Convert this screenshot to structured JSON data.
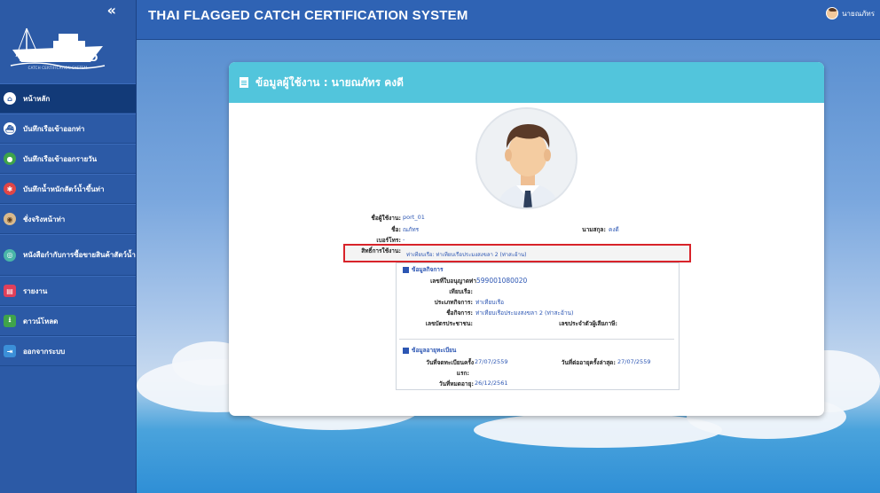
{
  "app": {
    "collapse_label": "«",
    "logo_text": "THAI FLAGGED",
    "logo_sub": "CATCH CERTIFICATION SYSTEM",
    "title": "THAI FLAGGED CATCH CERTIFICATION SYSTEM",
    "user_name": "นายณภัทร"
  },
  "sidebar": {
    "items": [
      {
        "label": "หน้าหลัก",
        "icon": "home-icon"
      },
      {
        "label": "บันทึกเรือเข้าออกท่า",
        "icon": "boat-icon"
      },
      {
        "label": "บันทึกเรือเข้าออกรายวัน",
        "icon": "calendar-boat-icon"
      },
      {
        "label": "บันทึกน้ำหนักสัตว์น้ำขึ้นท่า",
        "icon": "fish-icon"
      },
      {
        "label": "ชั่งจริงหน้าท่า",
        "icon": "scale-icon"
      },
      {
        "label": "หนังสือกำกับการซื้อขายสินค้าสัตว์น้ำ",
        "icon": "document-icon"
      },
      {
        "label": "รายงาน",
        "icon": "report-icon"
      },
      {
        "label": "ดาวน์โหลด",
        "icon": "download-icon"
      },
      {
        "label": "ออกจากระบบ",
        "icon": "logout-icon"
      }
    ]
  },
  "profile": {
    "heading": "ข้อมูลผู้ใช้งาน : นายณภัทร คงดี",
    "username_label": "ชื่อผู้ใช้งาน:",
    "username": "port_01",
    "firstname_label": "ชื่อ:",
    "firstname": "ณภัทร",
    "lastname_label": "นามสกุล:",
    "lastname": "คงดี",
    "phone_label": "เบอร์โทร:",
    "phone": "-",
    "permission_label": "สิทธิ์การใช้งาน:",
    "permission": "ท่าเทียบเรือ: ท่าเทียบเรือประมงสงขลา 2 (ท่าสะอ้าน)"
  },
  "business": {
    "title": "ข้อมูลกิจการ",
    "license_label": "เลขที่ใบอนุญาตท่า",
    "license": "599001080020",
    "pier_label": "เทียบเรือ:",
    "pier": "",
    "type_label": "ประเภทกิจการ:",
    "type": "ท่าเทียบเรือ",
    "name_label": "ชื่อกิจการ:",
    "name": "ท่าเทียบเรือประมงสงขลา 2 (ท่าสะอ้าน)",
    "citizen_label": "เลขบัตรประชาชน:",
    "citizen": "",
    "tax_label": "เลขประจำตัวผู้เสียภาษี:",
    "tax": ""
  },
  "registration": {
    "title": "ข้อมูลอายุทะเบียน",
    "first_reg_label": "วันที่จดทะเบียนครั้ง",
    "first_reg": "27/07/2559",
    "first_label_2": "แรก:",
    "latest_label": "วันที่ต่ออายุครั้งล่าสุด:",
    "latest": "27/07/2559",
    "expiry_label": "วันที่หมดอายุ:",
    "expiry": "26/12/2561"
  }
}
